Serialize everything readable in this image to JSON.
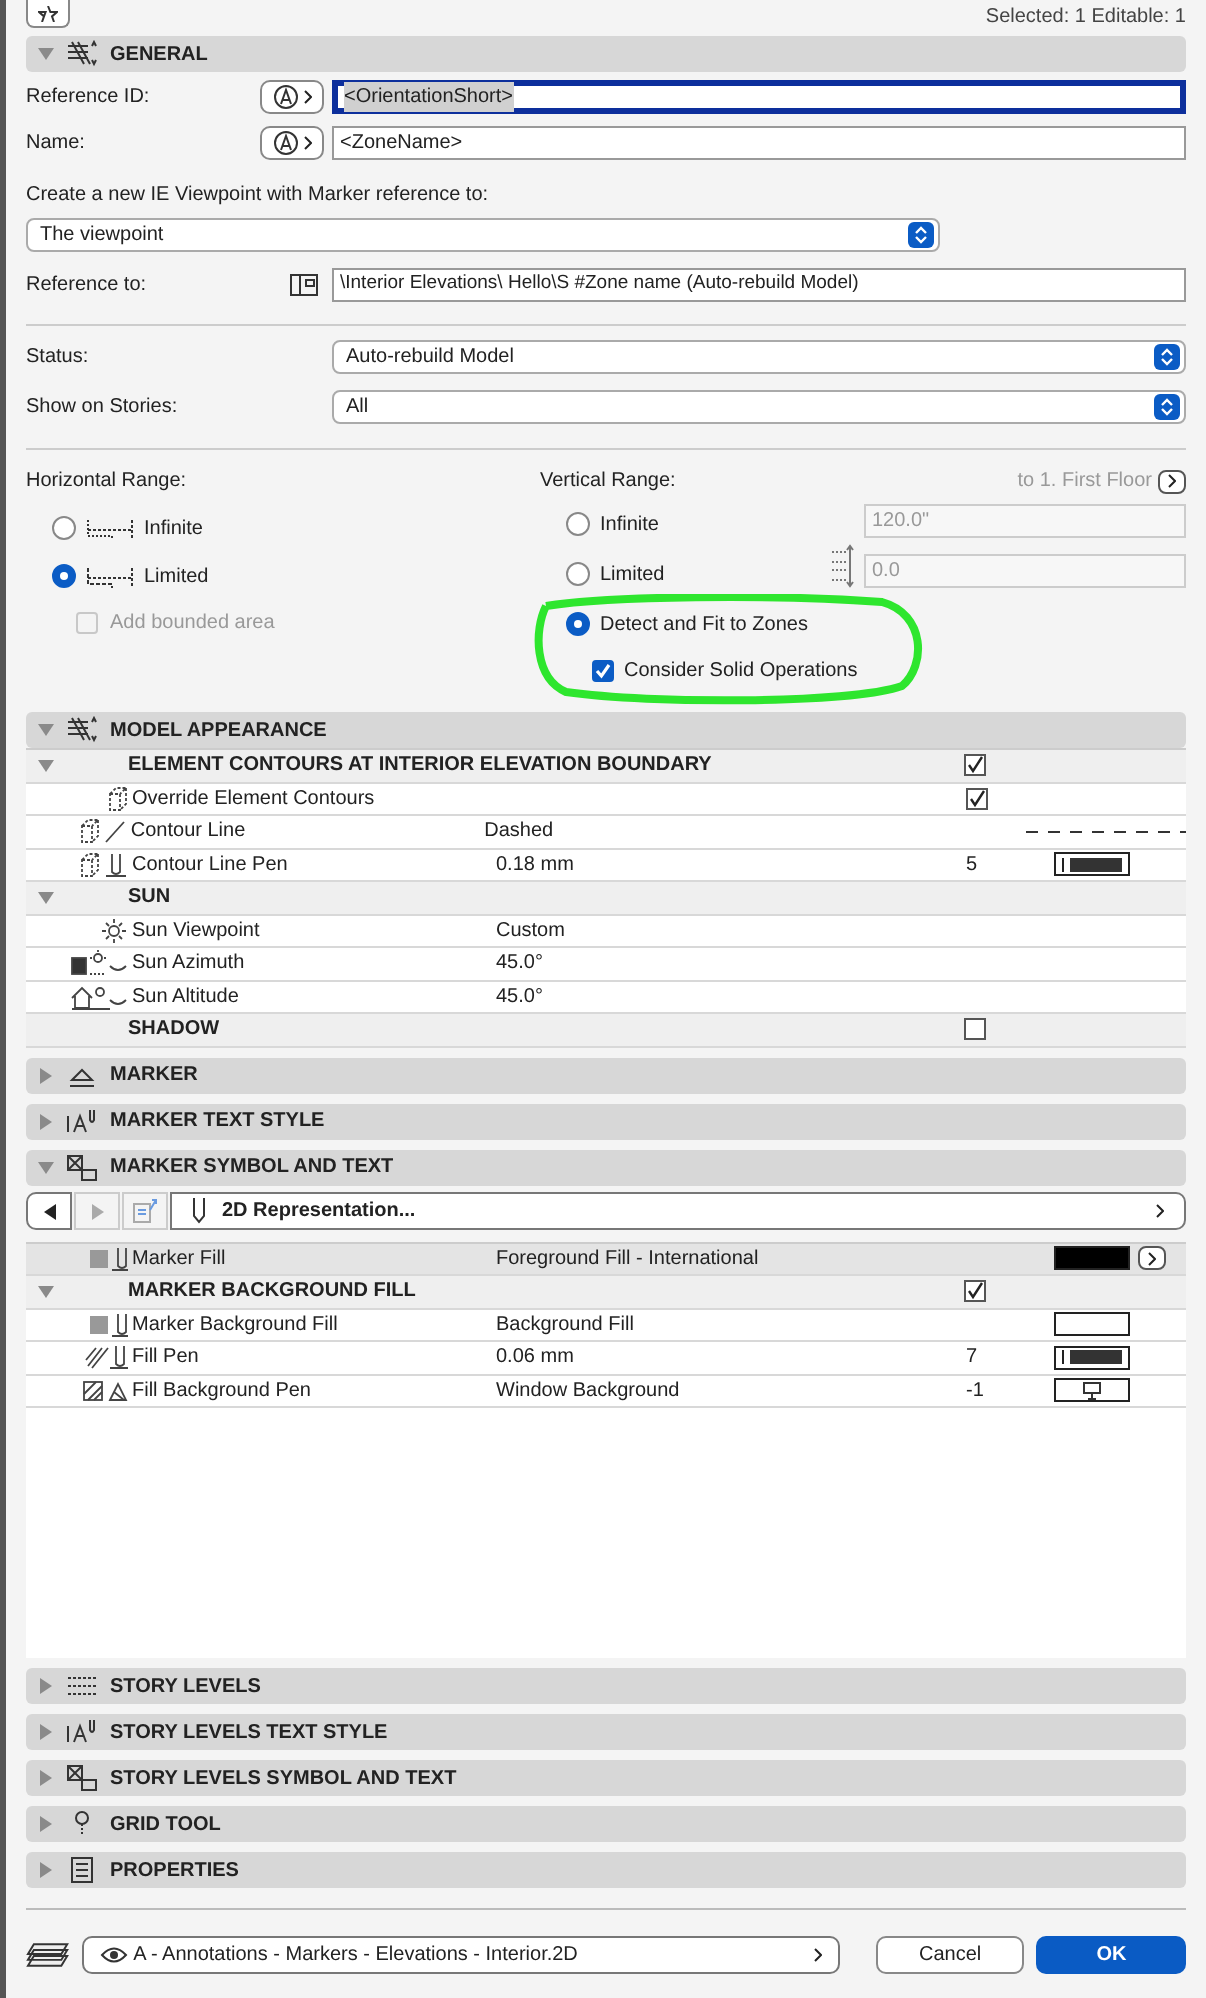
{
  "selection_info": "Selected: 1 Editable: 1",
  "general": {
    "title": "GENERAL",
    "expanded": true,
    "reference_id": {
      "label": "Reference ID:",
      "value": "<OrientationShort>",
      "focused": true
    },
    "name": {
      "label": "Name:",
      "value": "<ZoneName>",
      "focused": false
    },
    "viewpoint_prompt": "Create a new IE Viewpoint with Marker reference to:",
    "viewpoint_select": "The viewpoint",
    "reference_to": {
      "label": "Reference to:",
      "value": "\\Interior Elevations\\  Hello\\S #Zone name (Auto-rebuild Model)"
    },
    "status": {
      "label": "Status:",
      "value": "Auto-rebuild Model"
    },
    "show_on_stories": {
      "label": "Show on Stories:",
      "value": "All"
    },
    "horizontal_range": {
      "label": "Horizontal Range:",
      "options": [
        {
          "label": "Infinite",
          "selected": false
        },
        {
          "label": "Limited",
          "selected": true
        }
      ],
      "add_bounded_area": {
        "label": "Add bounded area",
        "checked": false,
        "disabled": true
      }
    },
    "vertical_range": {
      "label": "Vertical Range:",
      "story_link": "to 1. First Floor",
      "options": [
        {
          "label": "Infinite",
          "selected": false
        },
        {
          "label": "Limited",
          "selected": false
        },
        {
          "label": "Detect and Fit to Zones",
          "selected": true
        }
      ],
      "consider_solid": {
        "label": "Consider Solid Operations",
        "checked": true
      },
      "top_value": "120.0\"",
      "bottom_value": "0.0"
    }
  },
  "sections": [
    {
      "title": "MODEL APPEARANCE",
      "expanded": true,
      "rows": [
        {
          "kind": "group",
          "label": "ELEMENT CONTOURS AT INTERIOR ELEVATION BOUNDARY",
          "checked": true,
          "expanded": true
        },
        {
          "kind": "row",
          "label": "Override Element Contours",
          "checked": true,
          "selected": false
        },
        {
          "kind": "row",
          "label": "Contour Line",
          "value": "Dashed",
          "swatch": {
            "kind": "dashed"
          },
          "selected": false
        },
        {
          "kind": "row",
          "label": "Contour Line Pen",
          "value": "0.18 mm",
          "pen": "5",
          "swatch": {
            "kind": "pen"
          },
          "selected": false
        },
        {
          "kind": "group",
          "label": "SUN",
          "expanded": true
        },
        {
          "kind": "row",
          "label": "Sun Viewpoint",
          "value": "Custom",
          "selected": false
        },
        {
          "kind": "row",
          "label": "Sun Azimuth",
          "value": "45.0°",
          "selected": false
        },
        {
          "kind": "row",
          "label": "Sun Altitude",
          "value": "45.0°",
          "selected": false
        },
        {
          "kind": "group",
          "label": "SHADOW",
          "checked": false
        }
      ]
    },
    {
      "title": "MARKER",
      "expanded": false
    },
    {
      "title": "MARKER TEXT STYLE",
      "expanded": false
    },
    {
      "title": "MARKER SYMBOL AND TEXT",
      "expanded": true,
      "toolbar": {
        "dropdown": "2D Representation..."
      },
      "rows": [
        {
          "kind": "row",
          "label": "Marker Fill",
          "value": "Foreground Fill - International",
          "swatch": {
            "kind": "solid"
          },
          "more": true,
          "selected": true
        },
        {
          "kind": "group",
          "label": "MARKER BACKGROUND FILL",
          "checked": true,
          "expanded": true
        },
        {
          "kind": "row",
          "label": "Marker Background Fill",
          "value": "Background Fill",
          "swatch": {
            "kind": "empty"
          },
          "selected": false
        },
        {
          "kind": "row",
          "label": "Fill Pen",
          "value": "0.06 mm",
          "pen": "7",
          "swatch": {
            "kind": "pen"
          },
          "selected": false
        },
        {
          "kind": "row",
          "label": "Fill Background Pen",
          "value": "Window Background",
          "pen": "-1",
          "swatch": {
            "kind": "monitor"
          },
          "selected": false
        }
      ]
    },
    {
      "title": "STORY LEVELS",
      "expanded": false
    },
    {
      "title": "STORY LEVELS TEXT STYLE",
      "expanded": false
    },
    {
      "title": "STORY LEVELS SYMBOL AND TEXT",
      "expanded": false
    },
    {
      "title": "GRID TOOL",
      "expanded": false
    },
    {
      "title": "PROPERTIES",
      "expanded": false
    }
  ],
  "footer": {
    "layer": "A - Annotations - Markers - Elevations - Interior.2D",
    "buttons": [
      {
        "label": "Cancel",
        "kind": "secondary"
      },
      {
        "label": "OK",
        "kind": "primary"
      }
    ]
  }
}
